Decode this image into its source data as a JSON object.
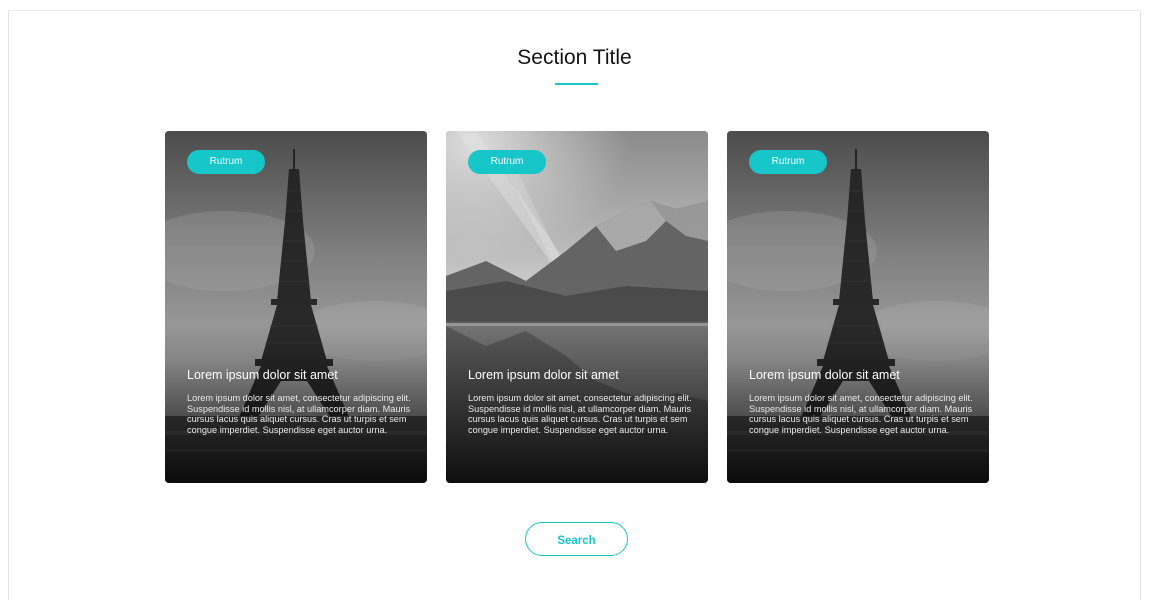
{
  "section": {
    "title": "Section Title"
  },
  "cards": [
    {
      "image_icon": "eiffel-tower-photo",
      "tag": "Rutrum",
      "title": "Lorem ipsum dolor sit amet",
      "body": "Lorem ipsum dolor sit amet, consectetur adipiscing elit. Suspendisse id mollis nisl, at ullamcorper diam. Mauris cursus lacus quis aliquet cursus. Cras ut turpis et sem congue imperdiet. Suspendisse eget auctor urna."
    },
    {
      "image_icon": "mountain-lake-photo",
      "tag": "Rutrum",
      "title": "Lorem ipsum dolor sit amet",
      "body": "Lorem ipsum dolor sit amet, consectetur adipiscing elit. Suspendisse id mollis nisl, at ullamcorper diam. Mauris cursus lacus quis aliquet cursus. Cras ut turpis et sem congue imperdiet. Suspendisse eget auctor urna."
    },
    {
      "image_icon": "eiffel-tower-photo",
      "tag": "Rutrum",
      "title": "Lorem ipsum dolor sit amet",
      "body": "Lorem ipsum dolor sit amet, consectetur adipiscing elit. Suspendisse id mollis nisl, at ullamcorper diam. Mauris cursus lacus quis aliquet cursus. Cras ut turpis et sem congue imperdiet. Suspendisse eget auctor urna."
    }
  ],
  "search_button": {
    "label": "Search"
  },
  "colors": {
    "accent": "#17c6c9",
    "title": "#141414",
    "card_text": "#ffffff"
  }
}
